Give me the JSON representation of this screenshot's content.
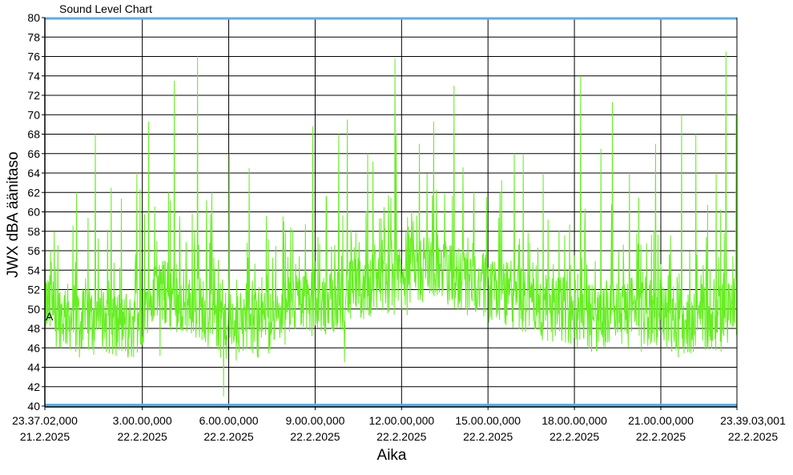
{
  "window_title": "Sound Level Chart",
  "chart_data": {
    "type": "line",
    "title": "Sound Level Chart",
    "xlabel": "Aika",
    "ylabel": "JWX dBA äänitaso",
    "ylim": [
      40,
      80
    ],
    "y_ticks": [
      40,
      42,
      44,
      46,
      48,
      50,
      52,
      54,
      56,
      58,
      60,
      62,
      64,
      66,
      68,
      70,
      72,
      74,
      76,
      78,
      80
    ],
    "x_range_hours": [
      0,
      24.025
    ],
    "x_ticks": [
      {
        "x": 0,
        "time": "23.37.02,000",
        "date": "21.2.2025"
      },
      {
        "x": 3.383,
        "time": "3.00.00,000",
        "date": "22.2.2025"
      },
      {
        "x": 6.383,
        "time": "6.00.00,000",
        "date": "22.2.2025"
      },
      {
        "x": 9.383,
        "time": "9.00.00,000",
        "date": "22.2.2025"
      },
      {
        "x": 12.383,
        "time": "12.00.00,000",
        "date": "22.2.2025"
      },
      {
        "x": 15.383,
        "time": "15.00.00,000",
        "date": "22.2.2025"
      },
      {
        "x": 18.383,
        "time": "18.00.00,000",
        "date": "22.2.2025"
      },
      {
        "x": 21.383,
        "time": "21.00.00,000",
        "date": "22.2.2025"
      },
      {
        "x": 24.025,
        "time": "23.39.03,001",
        "date": "22.2.2025"
      }
    ],
    "grid": true,
    "series_color": "#66ee22",
    "limit_line_color": "#5aaee6",
    "marker_label": "A",
    "series": [
      {
        "x": [
          0,
          0.5,
          1,
          1.5,
          2,
          2.5,
          3,
          3.5,
          4,
          4.5,
          5,
          5.5,
          6,
          6.5,
          7,
          7.5,
          8,
          8.5,
          9,
          9.5,
          10,
          10.5,
          11,
          11.5,
          12,
          12.5,
          13,
          13.5,
          14,
          14.5,
          15,
          15.5,
          16,
          16.5,
          17,
          17.5,
          18,
          18.5,
          19,
          19.5,
          20,
          20.5,
          21,
          21.5,
          22,
          22.5,
          23,
          23.5,
          24
        ],
        "y": [
          50.5,
          49.5,
          49,
          48.5,
          49,
          48.5,
          48,
          50,
          52,
          51,
          50.5,
          50,
          48.5,
          48,
          48.5,
          48.5,
          49,
          50,
          51.5,
          50,
          51,
          51.5,
          52,
          52.5,
          53,
          52.5,
          54,
          54.5,
          53.5,
          53,
          52.5,
          52,
          51.5,
          51,
          50.5,
          50,
          50,
          49.5,
          49,
          49.5,
          49.5,
          49.5,
          49.5,
          49,
          48.5,
          49,
          49,
          48.5,
          50
        ],
        "spikes": [
          {
            "x": 0.2,
            "y": 56
          },
          {
            "x": 1.1,
            "y": 62
          },
          {
            "x": 1.75,
            "y": 68
          },
          {
            "x": 2.3,
            "y": 62.5
          },
          {
            "x": 3.2,
            "y": 64
          },
          {
            "x": 3.6,
            "y": 69.3
          },
          {
            "x": 4.3,
            "y": 62
          },
          {
            "x": 4.5,
            "y": 73.5
          },
          {
            "x": 5.3,
            "y": 76
          },
          {
            "x": 5.8,
            "y": 62
          },
          {
            "x": 6.4,
            "y": 66
          },
          {
            "x": 7.1,
            "y": 64.5
          },
          {
            "x": 8.3,
            "y": 59
          },
          {
            "x": 9.3,
            "y": 68.8
          },
          {
            "x": 10.2,
            "y": 68
          },
          {
            "x": 10.5,
            "y": 69.5
          },
          {
            "x": 11.2,
            "y": 66
          },
          {
            "x": 12.2,
            "y": 68
          },
          {
            "x": 12.15,
            "y": 75.8
          },
          {
            "x": 13.0,
            "y": 67
          },
          {
            "x": 13.5,
            "y": 69.3
          },
          {
            "x": 14.2,
            "y": 73
          },
          {
            "x": 14.9,
            "y": 62
          },
          {
            "x": 15.8,
            "y": 62
          },
          {
            "x": 16.3,
            "y": 66
          },
          {
            "x": 16.6,
            "y": 66
          },
          {
            "x": 17.3,
            "y": 64
          },
          {
            "x": 18.6,
            "y": 74
          },
          {
            "x": 19.3,
            "y": 66.5
          },
          {
            "x": 19.7,
            "y": 71.3
          },
          {
            "x": 20.3,
            "y": 64
          },
          {
            "x": 21.2,
            "y": 67
          },
          {
            "x": 22.1,
            "y": 70
          },
          {
            "x": 22.6,
            "y": 68
          },
          {
            "x": 23.3,
            "y": 64
          },
          {
            "x": 23.65,
            "y": 76.5
          },
          {
            "x": 24.0,
            "y": 70
          }
        ],
        "dips": [
          {
            "x": 0.4,
            "y": 46
          },
          {
            "x": 1.2,
            "y": 45
          },
          {
            "x": 4.0,
            "y": 45.2
          },
          {
            "x": 6.1,
            "y": 45
          },
          {
            "x": 6.2,
            "y": 41
          },
          {
            "x": 10.4,
            "y": 44.5
          },
          {
            "x": 20.7,
            "y": 45.6
          },
          {
            "x": 21.6,
            "y": 46
          }
        ]
      }
    ]
  }
}
